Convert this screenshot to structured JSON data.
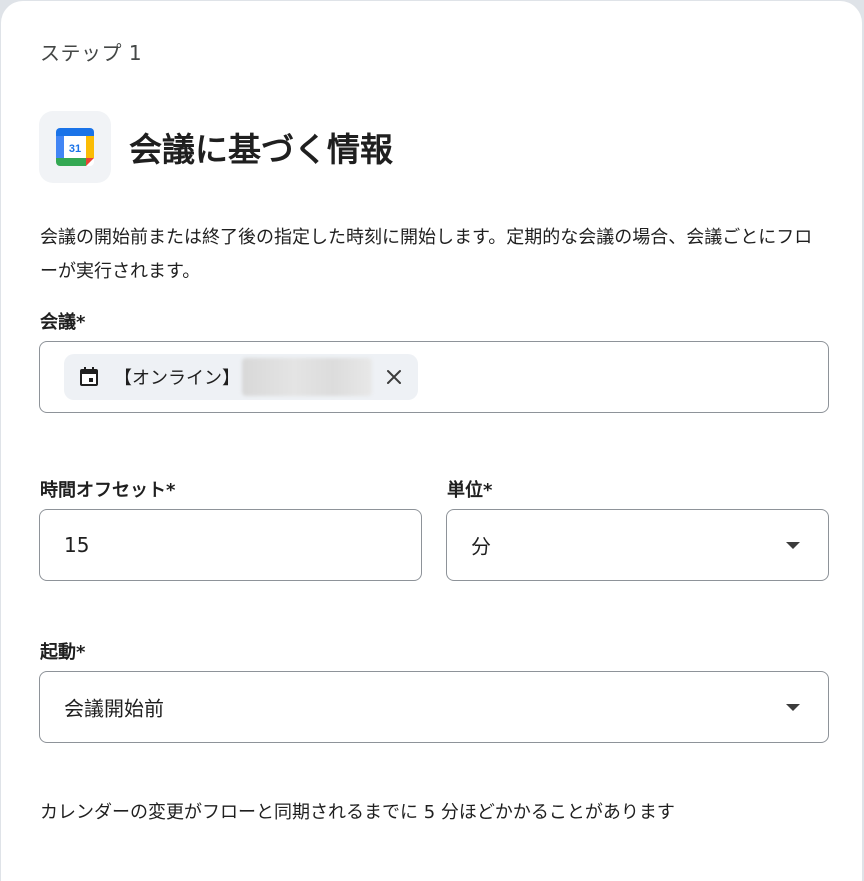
{
  "step_label": "ステップ 1",
  "app": {
    "icon": "google-calendar-icon",
    "calendar_day": "31"
  },
  "title": "会議に基づく情報",
  "description": "会議の開始前または終了後の指定した時刻に開始します。定期的な会議の場合、会議ごとにフローが実行されます。",
  "meeting": {
    "label": "会議*",
    "chip_icon": "calendar-event-icon",
    "chip_text": "【オンライン】",
    "remove_icon": "close-icon"
  },
  "offset": {
    "label": "時間オフセット*",
    "value": "15"
  },
  "unit": {
    "label": "単位*",
    "value": "分",
    "icon": "dropdown-arrow-icon"
  },
  "trigger": {
    "label": "起動*",
    "value": "会議開始前",
    "icon": "dropdown-arrow-icon"
  },
  "note": "カレンダーの変更がフローと同期されるまでに 5 分ほどかかることがあります",
  "colors": {
    "border": "#8e9399",
    "chip_bg": "#eef1f5",
    "icon_bg": "#f1f3f6"
  }
}
